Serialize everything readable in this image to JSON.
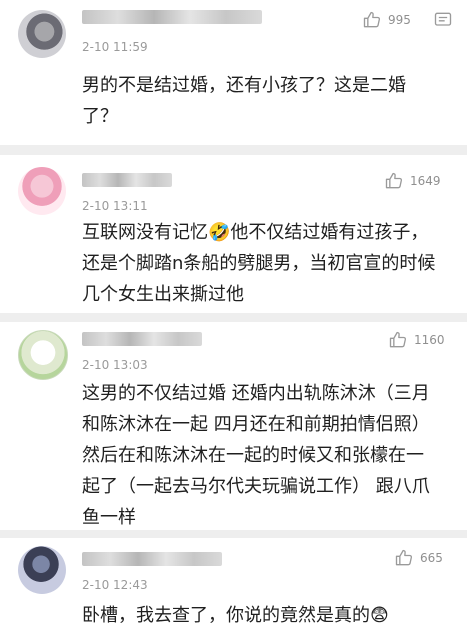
{
  "comments": [
    {
      "time": "2-10 11:59",
      "likes": "995",
      "text": "男的不是结过婚，还有小孩了？这是二婚了？",
      "avatar_icon": "pigeon-avatar"
    },
    {
      "time": "2-10 13:11",
      "likes": "1649",
      "text": "互联网没有记忆🤣他不仅结过婚有过孩子，还是个脚踏n条船的劈腿男，当初官宣的时候几个女生出来撕过他",
      "avatar_icon": "pink-cartoon-avatar"
    },
    {
      "time": "2-10 13:03",
      "likes": "1160",
      "text": "这男的不仅结过婚 还婚内出轨陈沐沐（三月和陈沐沐在一起 四月还在和前期拍情侣照）然后在和陈沐沐在一起的时候又和张檬在一起了（一起去马尔代夫玩骗说工作） 跟八爪鱼一样",
      "avatar_icon": "white-bear-avatar"
    },
    {
      "time": "2-10 12:43",
      "likes": "665",
      "text": "卧槽，我去查了，你说的竟然是真的😨",
      "avatar_icon": "anime-avatar"
    }
  ]
}
